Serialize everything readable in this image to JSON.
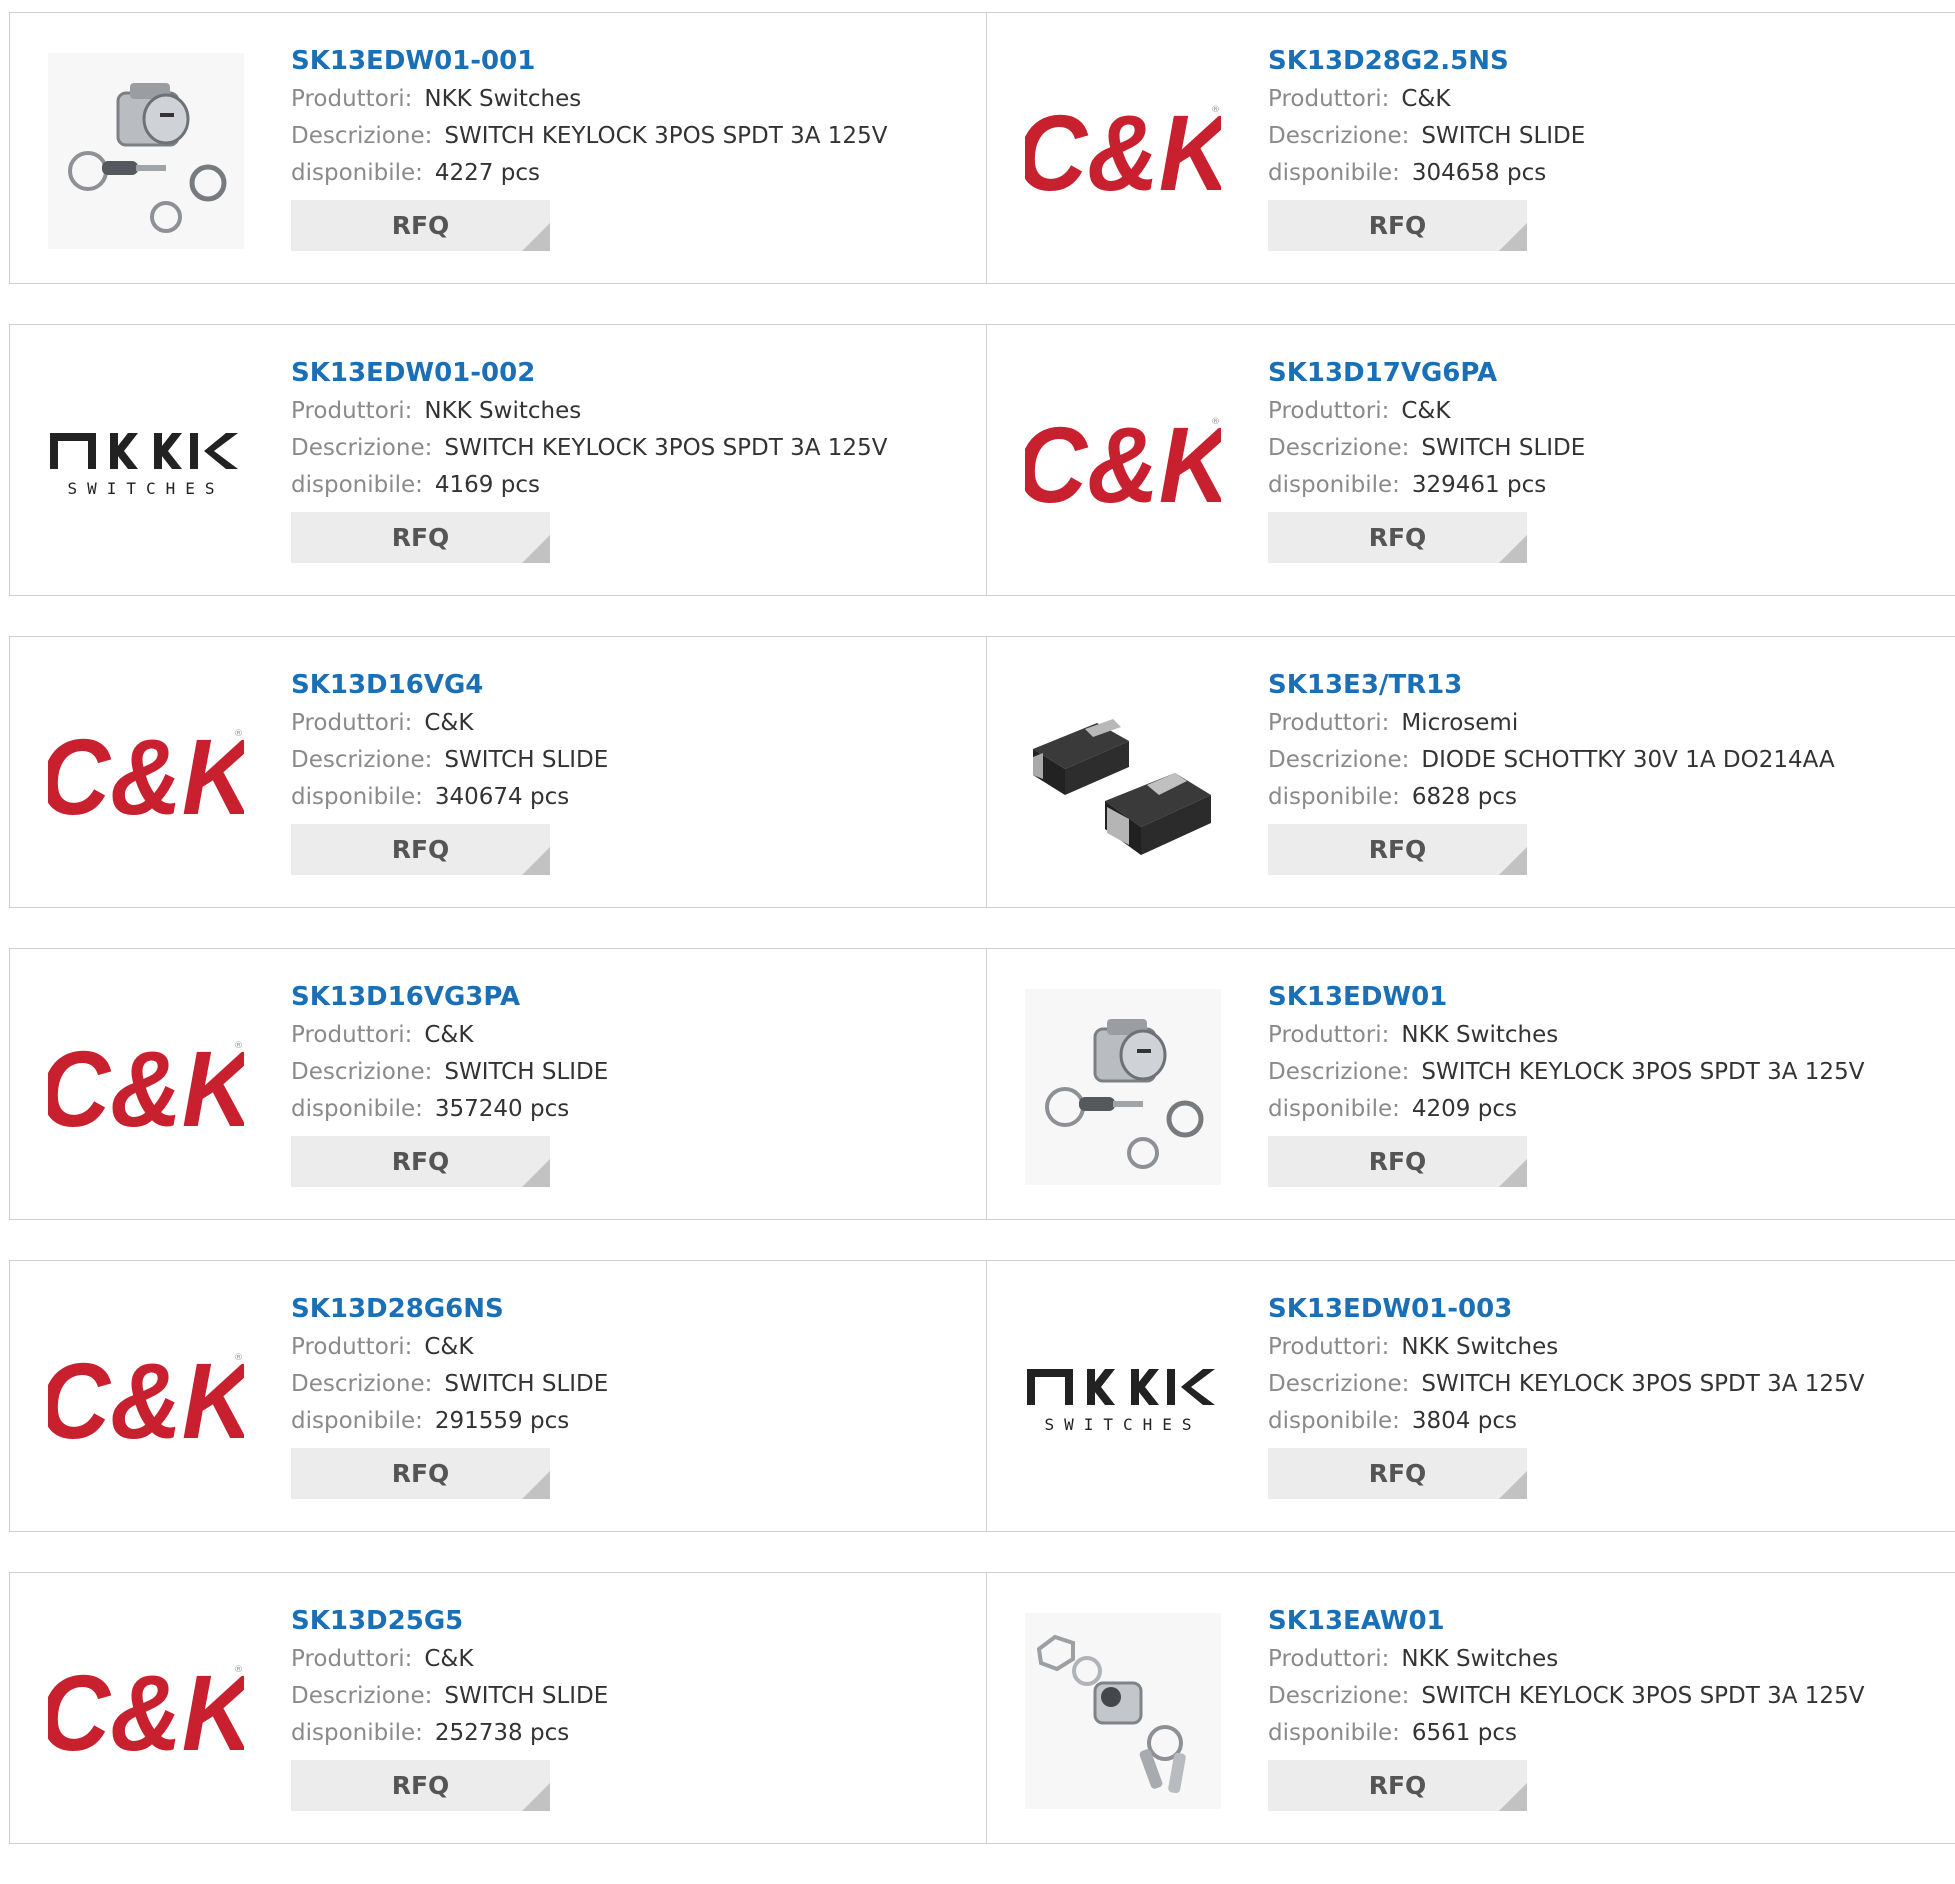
{
  "labels": {
    "manufacturer": "Produttori:",
    "description": "Descrizione:",
    "available": "disponibile:",
    "rfq": "RFQ"
  },
  "brands": {
    "ck_logo_text": "C&K",
    "nkk_logo_text": "NKK",
    "nkk_logo_sub": "SWITCHES"
  },
  "colors": {
    "part_link": "#1b6fb5",
    "ck_red": "#c8202f",
    "label_gray": "#8a8a8a",
    "rfq_bg": "#ececec"
  },
  "products": [
    {
      "part": "SK13EDW01-001",
      "manufacturer": "NKK Switches",
      "description": "SWITCH KEYLOCK 3POS SPDT 3A 125V",
      "available": "4227 pcs",
      "image": "keylock-switch-photo"
    },
    {
      "part": "SK13D28G2.5NS",
      "manufacturer": "C&K",
      "description": "SWITCH SLIDE",
      "available": "304658 pcs",
      "image": "ck-logo"
    },
    {
      "part": "SK13EDW01-002",
      "manufacturer": "NKK Switches",
      "description": "SWITCH KEYLOCK 3POS SPDT 3A 125V",
      "available": "4169 pcs",
      "image": "nkk-logo"
    },
    {
      "part": "SK13D17VG6PA",
      "manufacturer": "C&K",
      "description": "SWITCH SLIDE",
      "available": "329461 pcs",
      "image": "ck-logo"
    },
    {
      "part": "SK13D16VG4",
      "manufacturer": "C&K",
      "description": "SWITCH SLIDE",
      "available": "340674 pcs",
      "image": "ck-logo"
    },
    {
      "part": "SK13E3/TR13",
      "manufacturer": "Microsemi",
      "description": "DIODE SCHOTTKY 30V 1A DO214AA",
      "available": "6828 pcs",
      "image": "diode-photo"
    },
    {
      "part": "SK13D16VG3PA",
      "manufacturer": "C&K",
      "description": "SWITCH SLIDE",
      "available": "357240 pcs",
      "image": "ck-logo"
    },
    {
      "part": "SK13EDW01",
      "manufacturer": "NKK Switches",
      "description": "SWITCH KEYLOCK 3POS SPDT 3A 125V",
      "available": "4209 pcs",
      "image": "keylock-switch-photo"
    },
    {
      "part": "SK13D28G6NS",
      "manufacturer": "C&K",
      "description": "SWITCH SLIDE",
      "available": "291559 pcs",
      "image": "ck-logo"
    },
    {
      "part": "SK13EDW01-003",
      "manufacturer": "NKK Switches",
      "description": "SWITCH KEYLOCK 3POS SPDT 3A 125V",
      "available": "3804 pcs",
      "image": "nkk-logo"
    },
    {
      "part": "SK13D25G5",
      "manufacturer": "C&K",
      "description": "SWITCH SLIDE",
      "available": "252738 pcs",
      "image": "ck-logo"
    },
    {
      "part": "SK13EAW01",
      "manufacturer": "NKK Switches",
      "description": "SWITCH KEYLOCK 3POS SPDT 3A 125V",
      "available": "6561 pcs",
      "image": "keylock-switch-photo-alt"
    }
  ]
}
